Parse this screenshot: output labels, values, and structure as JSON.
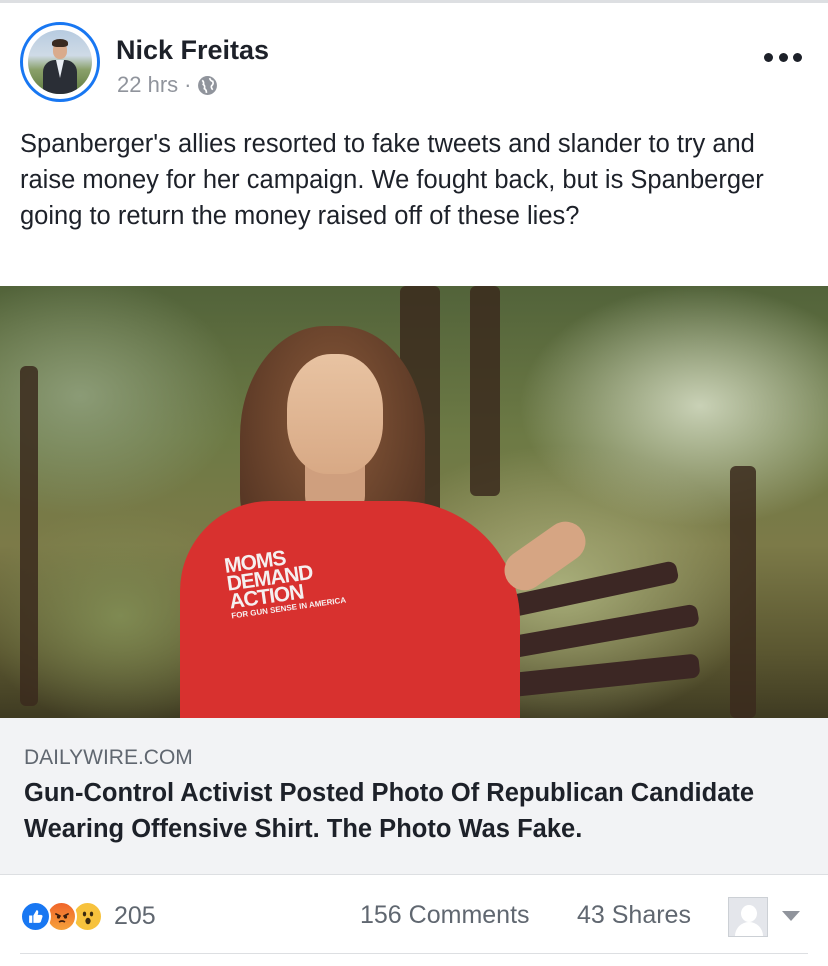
{
  "post": {
    "author": "Nick Freitas",
    "time": "22 hrs",
    "separator": "·",
    "privacy_icon": "globe-icon",
    "menu_icon": "more-dots-icon",
    "text": "Spanberger's allies resorted to fake tweets and slander to try and raise money for her campaign. We fought back, but is Spanberger going to return the money raised off of these lies?"
  },
  "link_preview": {
    "image_description_icon": "photo",
    "domain": "DAILYWIRE.COM",
    "title": "Gun-Control Activist Posted Photo Of Republican Candidate Wearing Offensive Shirt. The Photo Was Fake.",
    "shirt_text": [
      "MOMS",
      "DEMAND",
      "ACTION"
    ],
    "shirt_subtext": "FOR GUN SENSE IN AMERICA"
  },
  "footer": {
    "reactions": [
      "like-icon",
      "angry-icon",
      "wow-icon"
    ],
    "reaction_count": "205",
    "comments": "156 Comments",
    "shares": "43 Shares"
  },
  "colors": {
    "accent": "#1877f2",
    "text": "#1d2129",
    "muted": "#606770",
    "caption_bg": "#f2f3f5"
  }
}
